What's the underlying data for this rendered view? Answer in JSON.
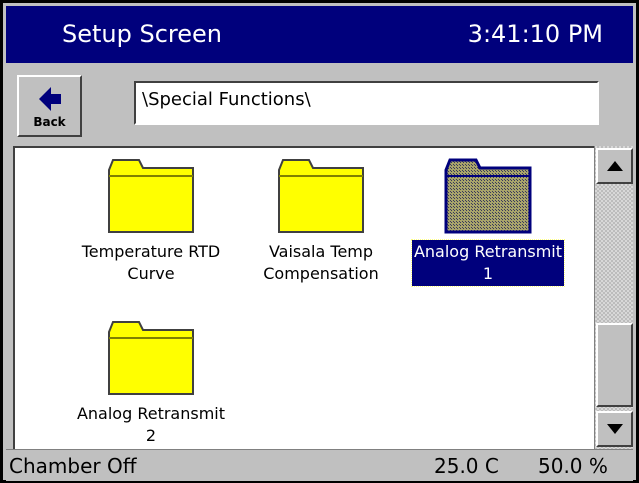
{
  "window": {
    "title": "Setup Screen",
    "clock": "3:41:10 PM"
  },
  "nav": {
    "back_label": "Back",
    "path": "\\Special Functions\\"
  },
  "items": [
    {
      "label_line1": "Temperature RTD",
      "label_line2": "Curve",
      "selected": false,
      "icon": "folder-icon"
    },
    {
      "label_line1": "Vaisala Temp",
      "label_line2": "Compensation",
      "selected": false,
      "icon": "folder-icon"
    },
    {
      "label_line1": "Analog Retransmit",
      "label_line2": "1",
      "selected": true,
      "icon": "folder-icon"
    },
    {
      "label_line1": "Analog Retransmit",
      "label_line2": "2",
      "selected": false,
      "icon": "folder-icon"
    }
  ],
  "status": {
    "state": "Chamber Off",
    "temperature": "25.0 C",
    "humidity": "50.0 %"
  },
  "colors": {
    "titlebar": "#00007c",
    "folder": "#ffff00",
    "folder_selected": "#8a8650",
    "background": "#c0c0c0"
  }
}
